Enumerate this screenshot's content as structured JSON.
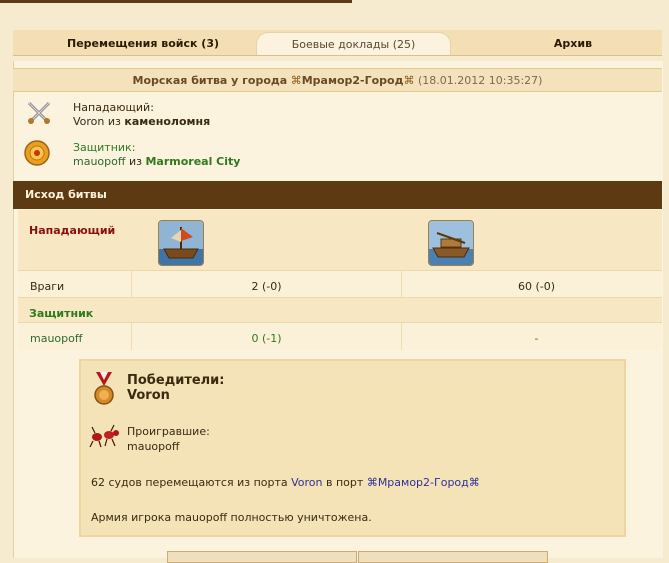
{
  "tabs": [
    {
      "label": "Перемещения войск (3)",
      "active": false
    },
    {
      "label": "Боевые доклады (25)",
      "active": true
    },
    {
      "label": "Архив",
      "active": false
    }
  ],
  "report": {
    "title_prefix": "Морская битва у города",
    "city_name": "Мрамор2-Город",
    "datetime": "(18.01.2012 10:35:27)"
  },
  "attacker": {
    "role_label": "Нападающий:",
    "name": "Voron",
    "from_word": "из",
    "location": "каменоломня"
  },
  "defender": {
    "role_label": "Защитник:",
    "name": "mauopoff",
    "from_word": "из",
    "location": "Marmoreal City"
  },
  "outcome": {
    "header": "Исход битвы",
    "attacker_label": "Нападающий",
    "defender_label": "Защитник",
    "rows": [
      {
        "name": "Враги",
        "unit1": "2 (-0)",
        "unit2": "60 (-0)"
      },
      {
        "name": "mauopoff",
        "unit1": "0 (-1)",
        "unit2": "-"
      }
    ]
  },
  "summary": {
    "winners_label": "Победители:",
    "winner": "Voron",
    "losers_label": "Проигравшие:",
    "loser": "mauopoff",
    "ships_prefix": "62 судов перемещаются из порта",
    "ships_from": "Voron",
    "ships_mid": "в порт",
    "ships_to": "Мрамор2-Город",
    "destroyed": "Армия игрока mauopoff полностью уничтожена."
  },
  "colors": {
    "dark_bar": "#5e3a13",
    "attacker_red": "#8b1010",
    "defender_green": "#2f7a1f",
    "link_blue": "#30309a"
  }
}
